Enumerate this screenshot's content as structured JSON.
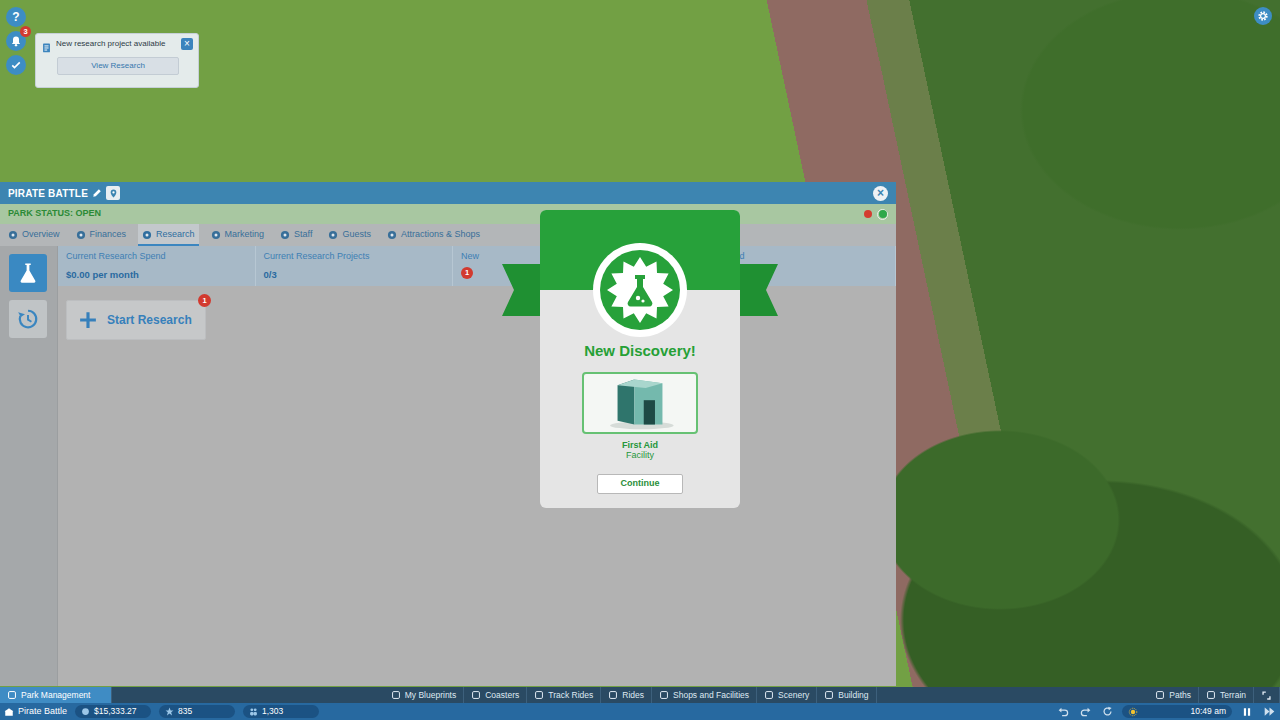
{
  "help": {
    "label": "?"
  },
  "notifications": {
    "badge": "3"
  },
  "notification": {
    "text": "New research project available",
    "close": "×",
    "button": "View Research"
  },
  "park_window": {
    "title": "PIRATE BATTLE",
    "close": "×",
    "status": "PARK STATUS: OPEN",
    "status_lights": [
      {
        "color": "#d43c30",
        "selected": false
      },
      {
        "color": "#2fa84a",
        "selected": true
      }
    ],
    "tabs": [
      {
        "label": "Overview",
        "selected": false
      },
      {
        "label": "Finances",
        "selected": false
      },
      {
        "label": "Research",
        "selected": true
      },
      {
        "label": "Marketing",
        "selected": false
      },
      {
        "label": "Staff",
        "selected": false
      },
      {
        "label": "Guests",
        "selected": false
      },
      {
        "label": "Attractions & Shops",
        "selected": false
      }
    ],
    "sidebar": [
      {
        "selected": true
      },
      {
        "selected": false
      }
    ],
    "stats": [
      {
        "kind": "value",
        "label": "Current Research Spend",
        "value": "$0.00 per month"
      },
      {
        "kind": "value",
        "label": "Current Research Projects",
        "value": "0/3"
      },
      {
        "kind": "badge",
        "label": "New",
        "badge": "1"
      },
      {
        "kind": "partial",
        "label": "ch Spend"
      }
    ],
    "start_button": {
      "label": "Start Research",
      "badge": "1"
    }
  },
  "modal": {
    "heading": "New Discovery!",
    "item_name": "First Aid",
    "item_type": "Facility",
    "button": "Continue"
  },
  "toolbar": {
    "left": [
      {
        "label": "Park Management",
        "selected": true
      }
    ],
    "center": [
      {
        "label": "My Blueprints",
        "selected": false
      },
      {
        "label": "Coasters",
        "selected": false
      },
      {
        "label": "Track Rides",
        "selected": false
      },
      {
        "label": "Rides",
        "selected": false
      },
      {
        "label": "Shops and Facilities",
        "selected": false
      },
      {
        "label": "Scenery",
        "selected": false
      },
      {
        "label": "Building",
        "selected": false
      }
    ],
    "right": [
      {
        "label": "Paths",
        "selected": false
      },
      {
        "label": "Terrain",
        "selected": false
      }
    ]
  },
  "status_bar": {
    "park": "Pirate Battle",
    "money": "$15,333.27",
    "rating": "835",
    "guests": "1,303",
    "time": "10:49 am"
  }
}
